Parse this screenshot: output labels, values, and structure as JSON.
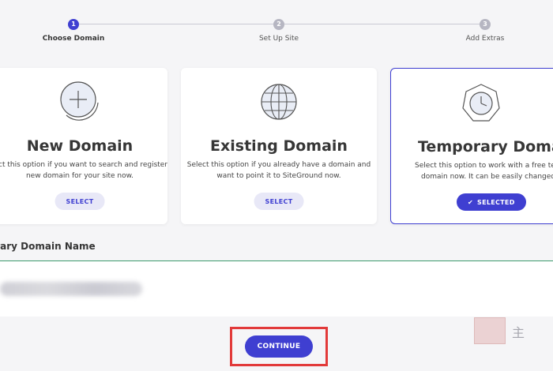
{
  "stepper": {
    "steps": [
      {
        "number": "1",
        "label": "Choose Domain"
      },
      {
        "number": "2",
        "label": "Set Up Site"
      },
      {
        "number": "3",
        "label": "Add Extras"
      }
    ]
  },
  "cards": [
    {
      "title": "New Domain",
      "desc_line1": "lect this option if you want to search and register a",
      "desc_line2": "new domain for your site now.",
      "button": "SELECT"
    },
    {
      "title": "Existing Domain",
      "desc_line1": "Select this option if you already have a domain and",
      "desc_line2": "want to point it to SiteGround now.",
      "button": "SELECT"
    },
    {
      "title": "Temporary Domain",
      "desc_line1": "Select this option to work with a free tempo",
      "desc_line2": "domain now. It can be easily changed late",
      "button": "SELECTED"
    }
  ],
  "domain_section": {
    "title": "orary Domain Name"
  },
  "continue": {
    "label": "CONTINUE"
  },
  "watermark": {
    "text": "主"
  },
  "colors": {
    "accent": "#3f3fd1",
    "highlight_frame": "#e23a3a",
    "divider": "#3c9b6e"
  }
}
